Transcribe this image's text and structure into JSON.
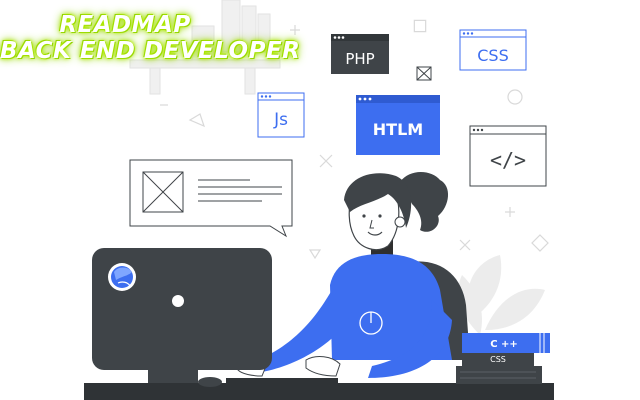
{
  "headline": {
    "line1": "READMAP",
    "line2": "BACK END DEVELOPER"
  },
  "code_windows": {
    "php": "PHP",
    "css": "CSS",
    "js": "Js",
    "html": "HTLM",
    "code_tag": "</>"
  },
  "books": {
    "top": "C ++",
    "bottom": "CSS"
  },
  "colors": {
    "accent_blue": "#3d6ef0",
    "dark_gray": "#3f4448",
    "headline_glow": "#a6e22e"
  }
}
